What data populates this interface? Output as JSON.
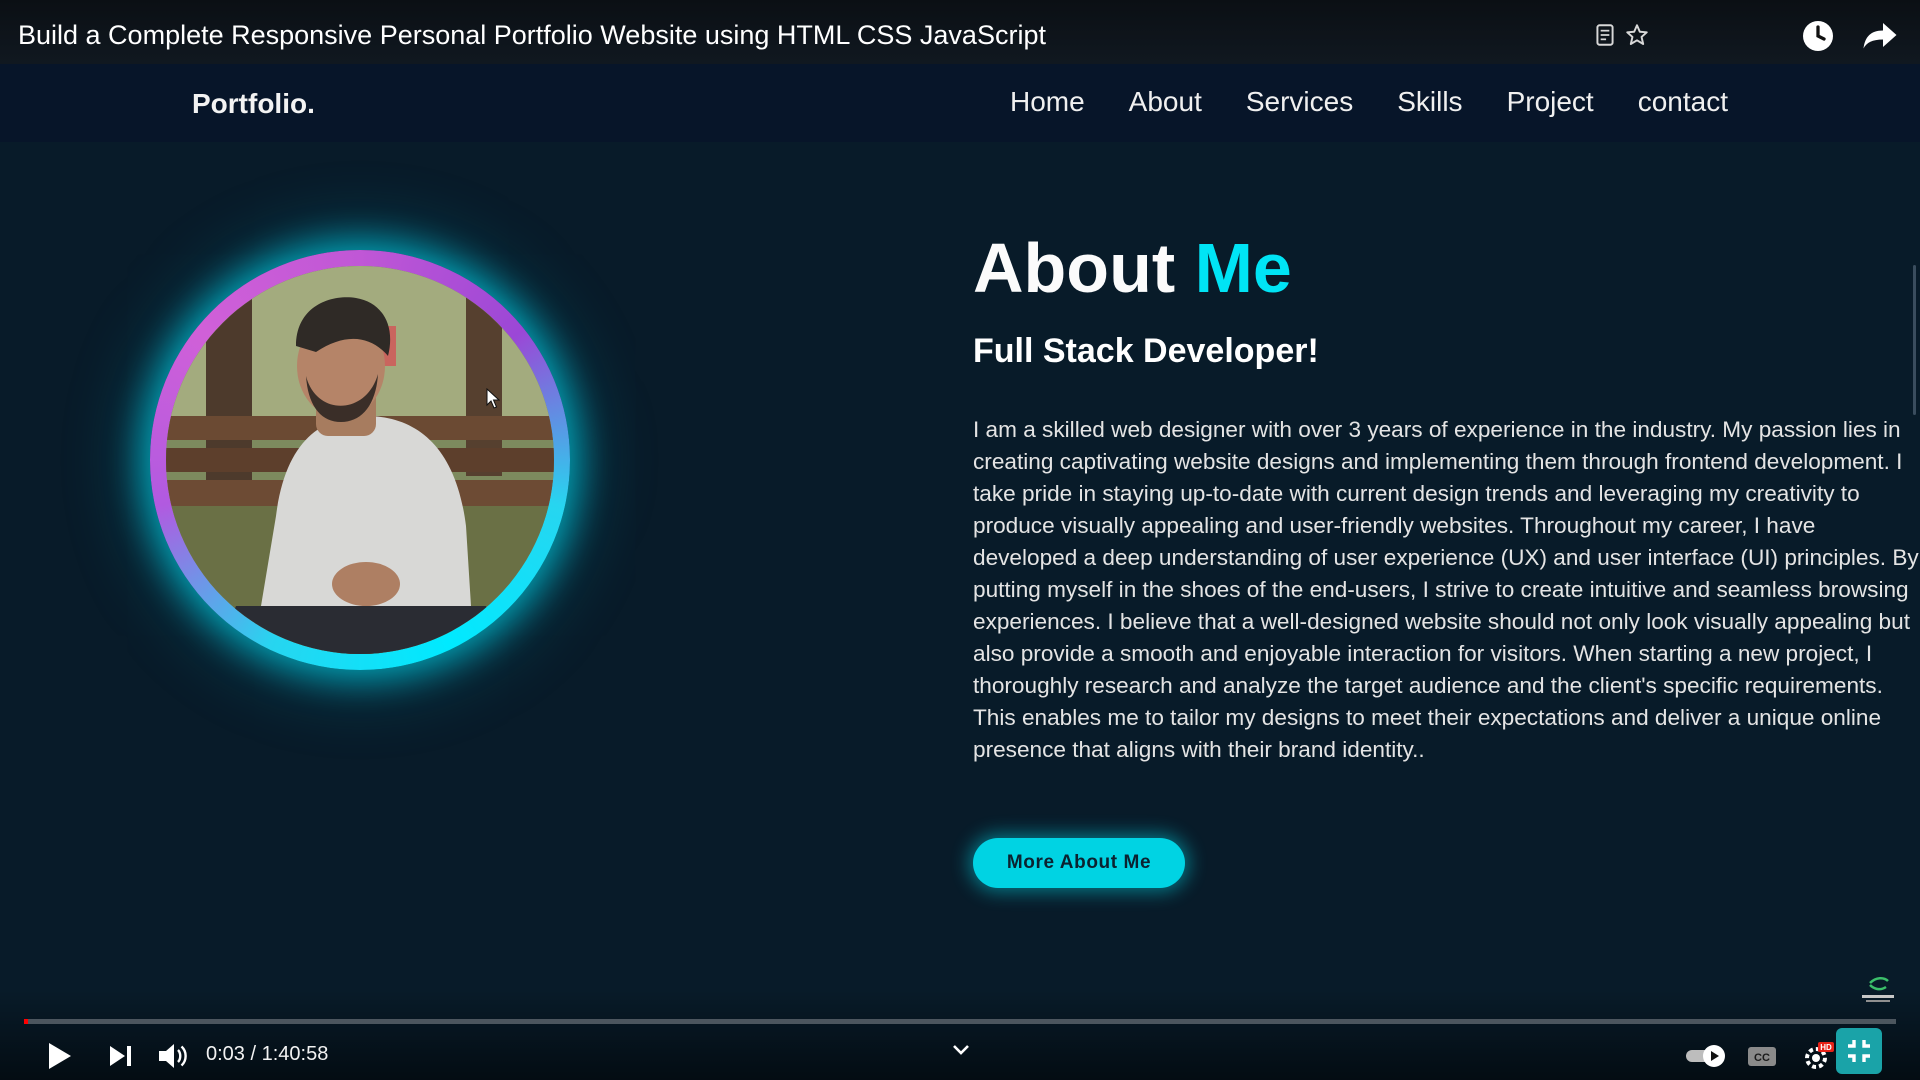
{
  "video": {
    "title": "Build a Complete Responsive Personal Portfolio Website using HTML CSS JavaScript",
    "time_current": "0:03",
    "time_separator": " / ",
    "time_total": "1:40:58",
    "progress_fraction": 0.0005,
    "icons": [
      "notes-icon",
      "star-icon",
      "watch-later-icon",
      "share-icon",
      "play-icon",
      "next-icon",
      "volume-icon",
      "chevron-down-icon",
      "autoplay-toggle",
      "cc-icon",
      "settings-icon",
      "hd-badge",
      "exit-fullscreen-icon"
    ]
  },
  "site": {
    "logo": "Portfolio.",
    "nav": [
      "Home",
      "About",
      "Services",
      "Skills",
      "Project",
      "contact"
    ]
  },
  "about": {
    "title_main": "About ",
    "title_accent": "Me",
    "subtitle": "Full Stack Developer!",
    "body": "I am a skilled web designer with over 3 years of experience in the industry. My passion lies in creating captivating website designs and implementing them through frontend development. I take pride in staying up-to-date with current design trends and leveraging my creativity to produce visually appealing and user-friendly websites. Throughout my career, I have developed a deep understanding of user experience (UX) and user interface (UI) principles. By putting myself in the shoes of the end-users, I strive to create intuitive and seamless browsing experiences. I believe that a well-designed website should not only look visually appealing but also provide a smooth and enjoyable interaction for visitors. When starting a new project, I thoroughly research and analyze the target audience and the client's specific requirements. This enables me to tailor my designs to meet their expectations and deliver a unique online presence that aligns with their brand identity..",
    "button": "More About Me",
    "accent_color": "#00e4f5"
  }
}
